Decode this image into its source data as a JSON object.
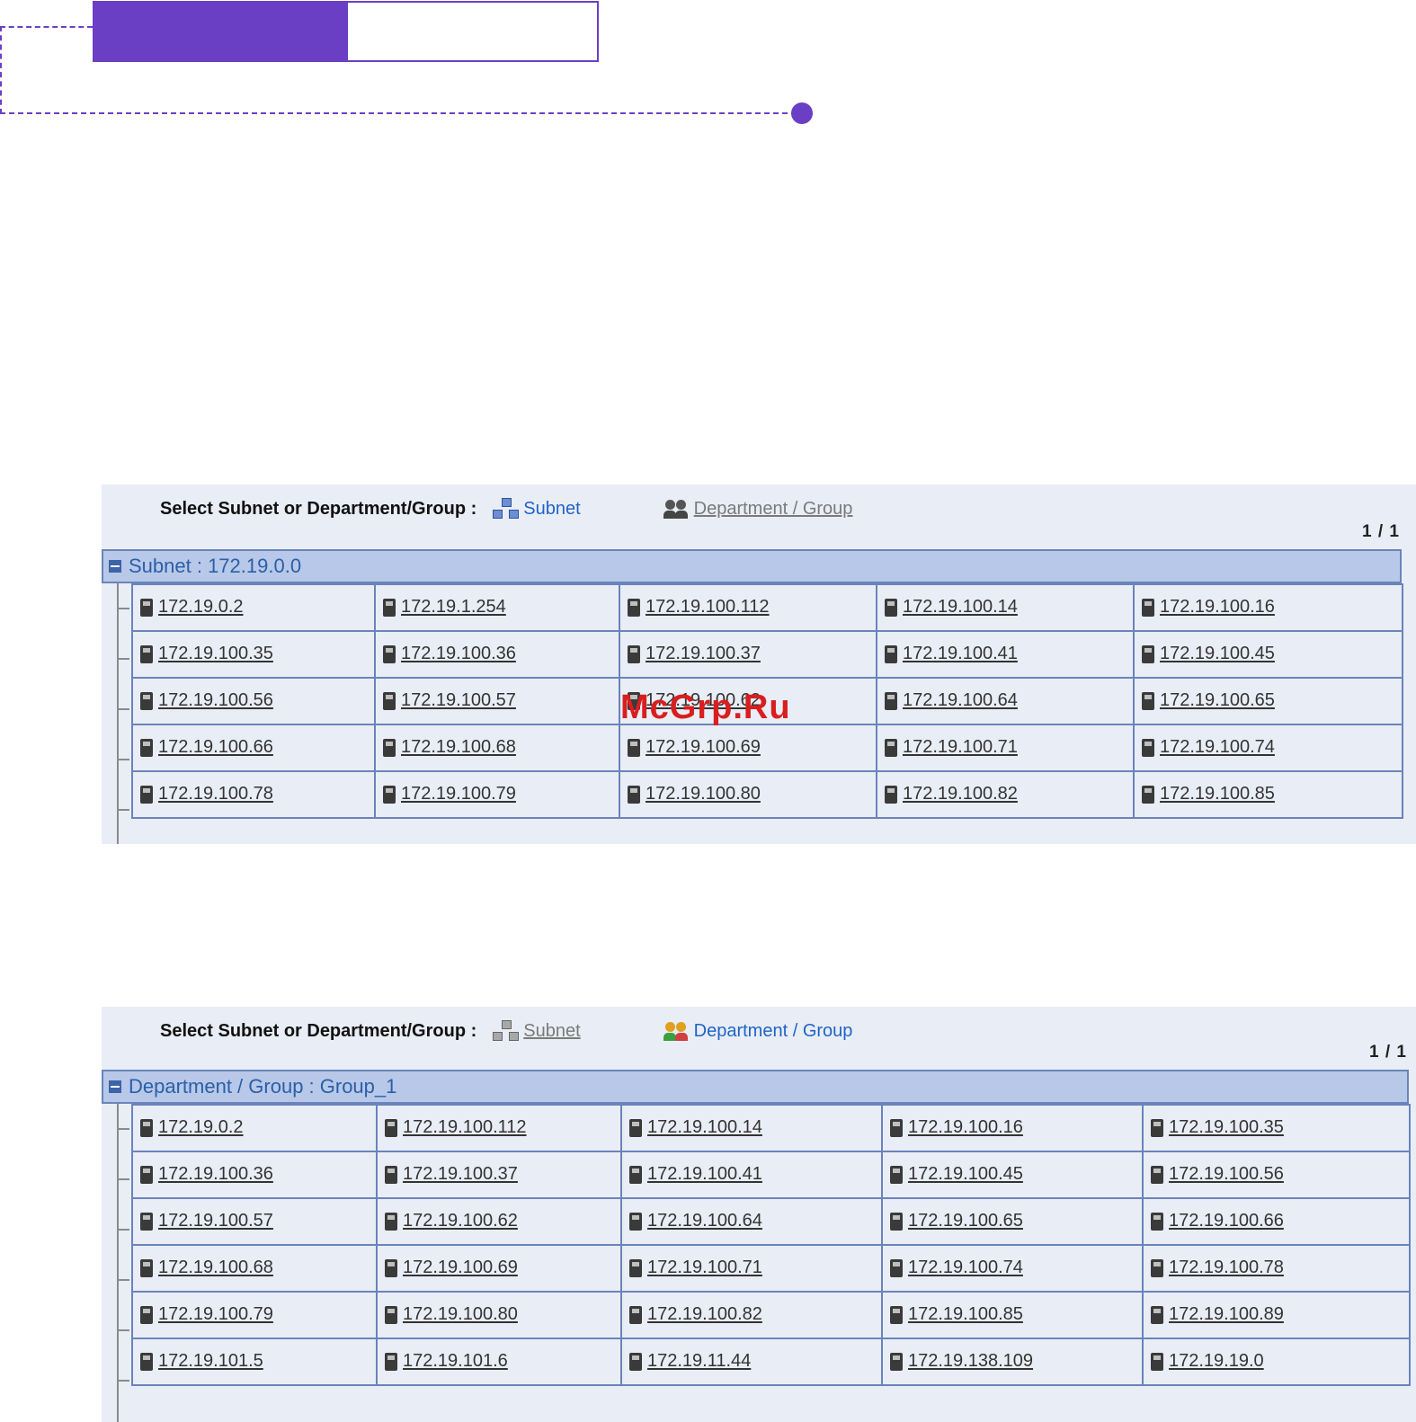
{
  "watermark": "McGrp.Ru",
  "panels": [
    {
      "select_label": "Select Subnet or Department/Group :",
      "subnet_label": "Subnet",
      "department_label": "Department / Group",
      "active": "subnet",
      "page": "1 / 1",
      "header": "Subnet : 172.19.0.0",
      "rows": [
        [
          "172.19.0.2",
          "172.19.1.254",
          "172.19.100.112",
          "172.19.100.14",
          "172.19.100.16"
        ],
        [
          "172.19.100.35",
          "172.19.100.36",
          "172.19.100.37",
          "172.19.100.41",
          "172.19.100.45"
        ],
        [
          "172.19.100.56",
          "172.19.100.57",
          "172.19.100.62",
          "172.19.100.64",
          "172.19.100.65"
        ],
        [
          "172.19.100.66",
          "172.19.100.68",
          "172.19.100.69",
          "172.19.100.71",
          "172.19.100.74"
        ],
        [
          "172.19.100.78",
          "172.19.100.79",
          "172.19.100.80",
          "172.19.100.82",
          "172.19.100.85"
        ]
      ]
    },
    {
      "select_label": "Select Subnet or Department/Group :",
      "subnet_label": "Subnet",
      "department_label": "Department / Group",
      "active": "department",
      "page": "1 / 1",
      "header": "Department / Group : Group_1",
      "rows": [
        [
          "172.19.0.2",
          "172.19.100.112",
          "172.19.100.14",
          "172.19.100.16",
          "172.19.100.35"
        ],
        [
          "172.19.100.36",
          "172.19.100.37",
          "172.19.100.41",
          "172.19.100.45",
          "172.19.100.56"
        ],
        [
          "172.19.100.57",
          "172.19.100.62",
          "172.19.100.64",
          "172.19.100.65",
          "172.19.100.66"
        ],
        [
          "172.19.100.68",
          "172.19.100.69",
          "172.19.100.71",
          "172.19.100.74",
          "172.19.100.78"
        ],
        [
          "172.19.100.79",
          "172.19.100.80",
          "172.19.100.82",
          "172.19.100.85",
          "172.19.100.89"
        ],
        [
          "172.19.101.5",
          "172.19.101.6",
          "172.19.11.44",
          "172.19.138.109",
          "172.19.19.0"
        ]
      ]
    }
  ],
  "colors": {
    "accent": "#6b3fc4",
    "panel_bg": "#e9edf5",
    "header_bar": "#b8c8e8",
    "border": "#6a84bb",
    "active_link": "#1f64c8",
    "watermark": "#d81f1f"
  },
  "icons": {
    "subnet": "network-icon",
    "department": "group-icon",
    "host": "computer-icon",
    "collapse": "minus-box-icon"
  }
}
